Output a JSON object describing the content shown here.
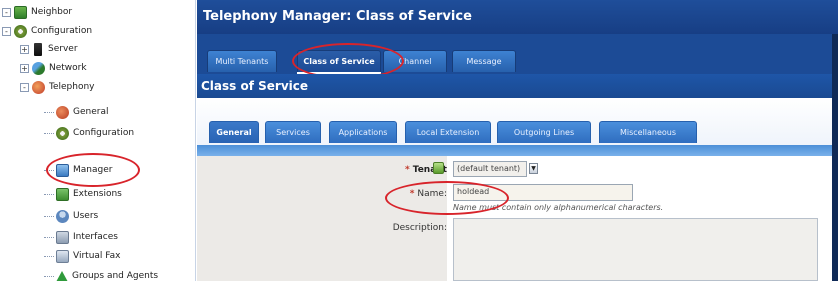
{
  "tree": {
    "items": [
      {
        "label": "Neighbor",
        "icon": "page-icon",
        "indent": 0
      },
      {
        "label": "Configuration",
        "icon": "gear-icon",
        "indent": 0
      },
      {
        "label": "Server",
        "icon": "server-icon",
        "indent": 1
      },
      {
        "label": "Network",
        "icon": "network-icon",
        "indent": 1
      },
      {
        "label": "Telephony",
        "icon": "phone-icon",
        "indent": 1
      },
      {
        "label": "General",
        "icon": "general-icon",
        "indent": 2
      },
      {
        "label": "Configuration",
        "icon": "gear-icon",
        "indent": 2
      },
      {
        "label": "Manager",
        "icon": "manager-icon",
        "indent": 2
      },
      {
        "label": "Extensions",
        "icon": "extensions-icon",
        "indent": 2
      },
      {
        "label": "Users",
        "icon": "users-icon",
        "indent": 2
      },
      {
        "label": "Interfaces",
        "icon": "interfaces-icon",
        "indent": 2
      },
      {
        "label": "Virtual Fax",
        "icon": "virtual-fax-icon",
        "indent": 2
      },
      {
        "label": "Groups and Agents",
        "icon": "warning-icon",
        "indent": 2
      }
    ]
  },
  "header": {
    "title": "Telephony Manager:  Class of Service"
  },
  "top_tabs": [
    {
      "label": "Multi Tenants",
      "active": false
    },
    {
      "label": "Class of Service",
      "active": true
    },
    {
      "label": "Channel",
      "active": false
    },
    {
      "label": "Message",
      "active": false
    }
  ],
  "section": {
    "title": "Class of Service"
  },
  "sub_tabs": [
    {
      "label": "General",
      "active": true
    },
    {
      "label": "Services",
      "active": false
    },
    {
      "label": "Applications",
      "active": false
    },
    {
      "label": "Local Extension",
      "active": false
    },
    {
      "label": "Outgoing Lines",
      "active": false
    },
    {
      "label": "Miscellaneous",
      "active": false
    }
  ],
  "form": {
    "tenant_label": "Tenant",
    "tenant_value": "(default tenant)",
    "name_label": "Name:",
    "name_value": "holdead",
    "name_hint": "Name must contain only alphanumerical characters.",
    "description_label": "Description:",
    "description_value": ""
  },
  "colors": {
    "title_blue": "#1f4e9a",
    "tab_blue": "#2f6dbf",
    "annotation_red": "#d8242b"
  }
}
